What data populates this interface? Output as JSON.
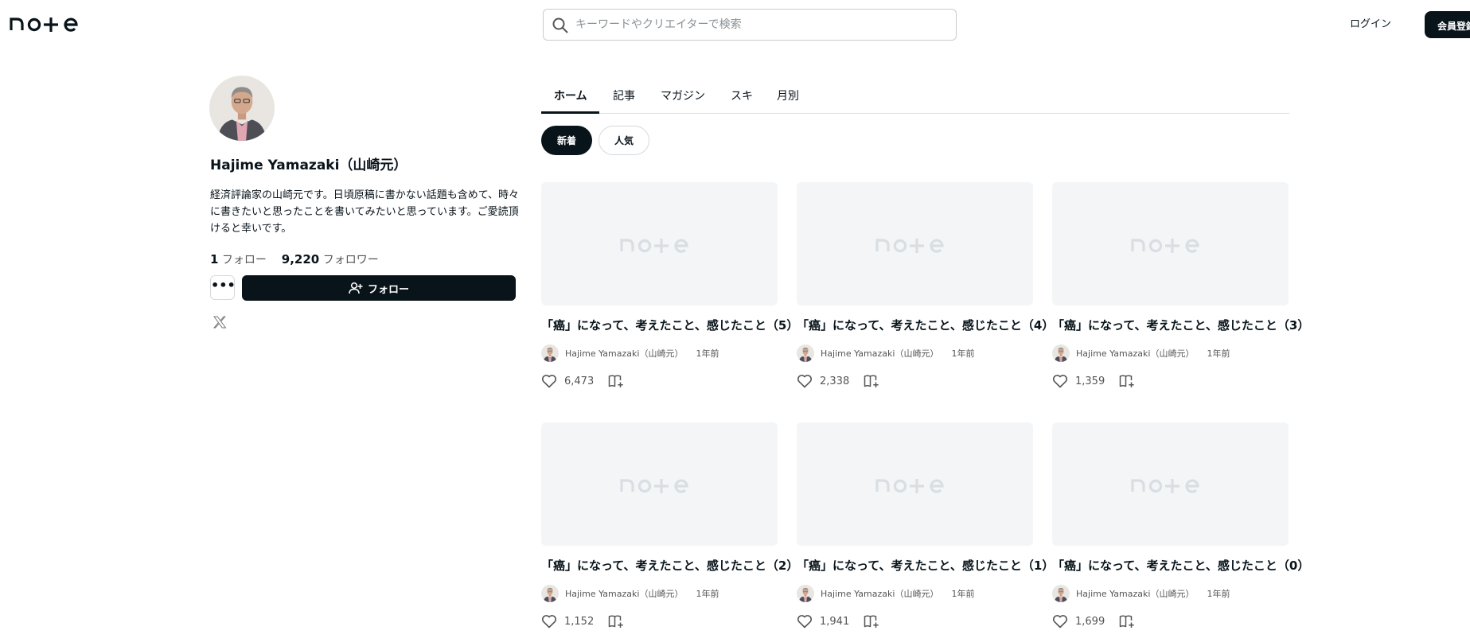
{
  "header": {
    "logo_text": "note",
    "search_placeholder": "キーワードやクリエイターで検索",
    "login_label": "ログイン",
    "signup_label": "会員登録"
  },
  "profile": {
    "name": "Hajime Yamazaki（山崎元）",
    "bio": "経済評論家の山崎元です。日頃原稿に書かない話題も含めて、時々に書きたいと思ったことを書いてみたいと思っています。ご愛読頂けると幸いです。",
    "following_count": "1",
    "following_label": "フォロー",
    "followers_count": "9,220",
    "followers_label": "フォロワー",
    "more_label": "•••",
    "follow_label": "フォロー"
  },
  "tabs": [
    {
      "label": "ホーム",
      "active": true
    },
    {
      "label": "記事",
      "active": false
    },
    {
      "label": "マガジン",
      "active": false
    },
    {
      "label": "スキ",
      "active": false
    },
    {
      "label": "月別",
      "active": false
    }
  ],
  "filters": [
    {
      "label": "新着",
      "active": true
    },
    {
      "label": "人気",
      "active": false
    }
  ],
  "articles": [
    {
      "title": "「癌」になって、考えたこと、感じたこと（5）",
      "author": "Hajime Yamazaki（山崎元）",
      "time": "1年前",
      "likes": "6,473"
    },
    {
      "title": "「癌」になって、考えたこと、感じたこと（4）",
      "author": "Hajime Yamazaki（山崎元）",
      "time": "1年前",
      "likes": "2,338"
    },
    {
      "title": "「癌」になって、考えたこと、感じたこと（3）",
      "author": "Hajime Yamazaki（山崎元）",
      "time": "1年前",
      "likes": "1,359"
    },
    {
      "title": "「癌」になって、考えたこと、感じたこと（2）",
      "author": "Hajime Yamazaki（山崎元）",
      "time": "1年前",
      "likes": "1,152"
    },
    {
      "title": "「癌」になって、考えたこと、感じたこと（1）",
      "author": "Hajime Yamazaki（山崎元）",
      "time": "1年前",
      "likes": "1,941"
    },
    {
      "title": "「癌」になって、考えたこと、感じたこと（0）",
      "author": "Hajime Yamazaki（山崎元）",
      "time": "1年前",
      "likes": "1,699"
    }
  ],
  "colors": {
    "primary": "#08131a",
    "thumbnail_bg": "#f3f5f7",
    "thumbnail_logo": "#d9dee3"
  },
  "icons": [
    "search-icon",
    "user-plus-icon",
    "x-logo-icon",
    "heart-icon",
    "magazine-add-icon"
  ]
}
